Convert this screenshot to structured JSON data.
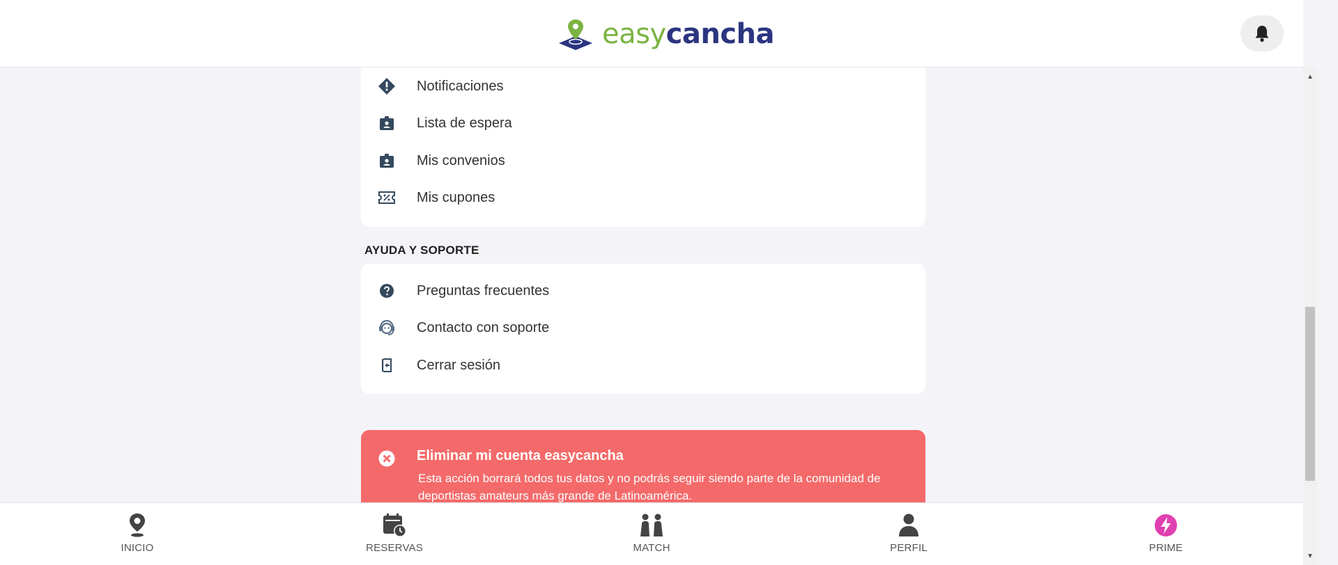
{
  "header": {
    "logo": {
      "part1": "easy",
      "part2": "cancha"
    },
    "icons": {
      "logo": "pin-on-field-logo",
      "bell": "bell-icon"
    },
    "colors": {
      "brand_green": "#7cb342",
      "brand_navy": "#2b3580"
    }
  },
  "account_menu": {
    "items": [
      {
        "label": "Notificaciones",
        "icon": "alert-diamond-icon"
      },
      {
        "label": "Lista de espera",
        "icon": "id-badge-icon"
      },
      {
        "label": "Mis convenios",
        "icon": "id-badge-icon"
      },
      {
        "label": "Mis cupones",
        "icon": "coupon-icon"
      }
    ]
  },
  "help_section": {
    "title": "AYUDA Y SOPORTE",
    "items": [
      {
        "label": "Preguntas frecuentes",
        "icon": "question-circle-icon"
      },
      {
        "label": "Contacto con soporte",
        "icon": "support-agent-icon"
      },
      {
        "label": "Cerrar sesión",
        "icon": "logout-icon"
      }
    ]
  },
  "delete_account": {
    "title": "Eliminar mi cuenta easycancha",
    "description": "Esta acción borrará todos tus datos y no podrás seguir siendo parte de la comunidad de deportistas amateurs más grande de Latinoamérica.",
    "icon": "close-circle-icon",
    "color": "#f46a6a"
  },
  "bottom_nav": {
    "items": [
      {
        "label": "INICIO",
        "icon": "location-pin-icon"
      },
      {
        "label": "RESERVAS",
        "icon": "calendar-clock-icon"
      },
      {
        "label": "MATCH",
        "icon": "players-match-icon"
      },
      {
        "label": "PERFIL",
        "icon": "person-icon"
      },
      {
        "label": "PRIME",
        "icon": "bolt-circle-icon"
      }
    ],
    "prime_color": "#e040b0"
  }
}
